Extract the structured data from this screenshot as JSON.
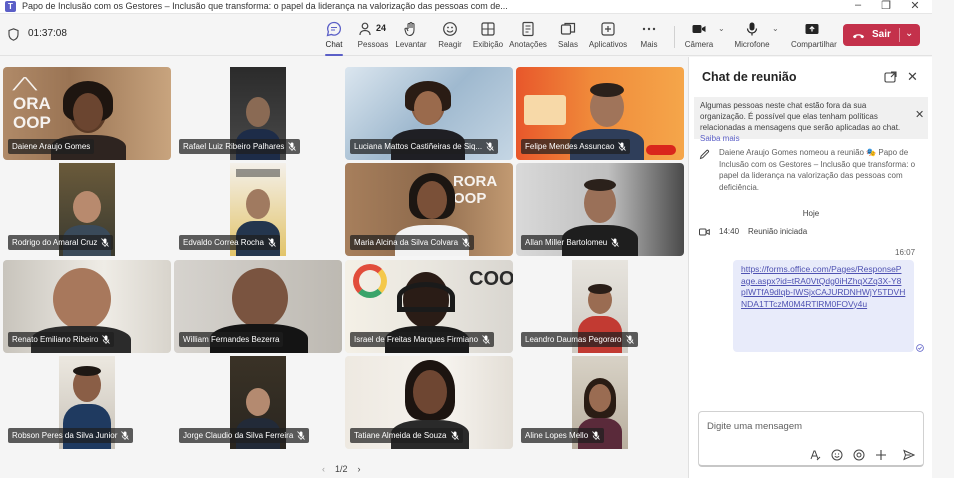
{
  "window": {
    "title": "Papo de Inclusão com os Gestores – Inclusão que transforma: o papel da liderança na valorização das pessoas com de..."
  },
  "toolbar": {
    "timer": "01:37:08",
    "participant_count": "24",
    "buttons": [
      {
        "id": "chat",
        "label": "Chat",
        "icon": "chat-icon",
        "active": true
      },
      {
        "id": "pessoas",
        "label": "Pessoas",
        "icon": "people-icon"
      },
      {
        "id": "levantar",
        "label": "Levantar",
        "icon": "raise-hand-icon"
      },
      {
        "id": "reagir",
        "label": "Reagir",
        "icon": "react-icon"
      },
      {
        "id": "exibicao",
        "label": "Exibição",
        "icon": "view-icon"
      },
      {
        "id": "anotacoes",
        "label": "Anotações",
        "icon": "notes-icon"
      },
      {
        "id": "salas",
        "label": "Salas",
        "icon": "rooms-icon"
      },
      {
        "id": "aplicativos",
        "label": "Aplicativos",
        "icon": "apps-icon"
      },
      {
        "id": "mais",
        "label": "Mais",
        "icon": "more-icon"
      },
      {
        "id": "camera",
        "label": "Câmera",
        "icon": "camera-icon"
      },
      {
        "id": "microfone",
        "label": "Microfone",
        "icon": "mic-icon"
      },
      {
        "id": "compartilhar",
        "label": "Compartilhar",
        "icon": "share-icon"
      }
    ],
    "leave_label": "Sair",
    "leave_color": "#c4314b",
    "accent_color": "#5b5fc7"
  },
  "gallery": {
    "participants": [
      {
        "name": "Daiene Araujo Gomes",
        "muted": false
      },
      {
        "name": "Rafael Luiz Ribeiro Palhares",
        "muted": true
      },
      {
        "name": "Luciana Mattos Castiñeiras de Siq...",
        "muted": true
      },
      {
        "name": "Felipe Mendes Assuncao",
        "muted": true
      },
      {
        "name": "Rodrigo do Amaral Cruz",
        "muted": true
      },
      {
        "name": "Edvaldo Correa Rocha",
        "muted": true
      },
      {
        "name": "Maria Alcina da Silva Colvara",
        "muted": true
      },
      {
        "name": "Allan Miller Bartolomeu",
        "muted": true
      },
      {
        "name": "Renato Emiliano Ribeiro",
        "muted": true
      },
      {
        "name": "William Fernandes Bezerra",
        "muted": false
      },
      {
        "name": "Israel de Freitas Marques Firmiano",
        "muted": true
      },
      {
        "name": "Leandro Daumas Pegoraro",
        "muted": true
      },
      {
        "name": "Robson Peres da Silva Junior",
        "muted": true
      },
      {
        "name": "Jorge Claudio da Silva Ferreira",
        "muted": true
      },
      {
        "name": "Tatiane Almeida de Souza",
        "muted": true
      },
      {
        "name": "Aline Lopes Mello",
        "muted": true
      }
    ],
    "page": "1/2"
  },
  "chat": {
    "title": "Chat de reunião",
    "banner_text": "Algumas pessoas neste chat estão fora da sua organização. É possível que elas tenham políticas relacionadas a mensagens que serão aplicadas ao chat.",
    "banner_link": "Saiba mais",
    "rename_event": "Daiene Araujo Gomes nomeou a reunião 🎭 Papo de Inclusão com os Gestores – Inclusão que transforma: o papel da liderança na valorização das pessoas com deficiência.",
    "day_label": "Hoje",
    "meeting_time": "14:40",
    "meeting_started": "Reunião iniciada",
    "message_time": "16:07",
    "message_link": "https://forms.office.com/Pages/ResponsePage.aspx?id=tRA0VtQdg0iHZhqXZq3X-Y8pIWTfA9dlqb-IWSjxCAJURDNHWjY5TDVHNDA1TTczM0M4RTlRM0FOVy4u",
    "composer_placeholder": "Digite uma mensagem"
  }
}
